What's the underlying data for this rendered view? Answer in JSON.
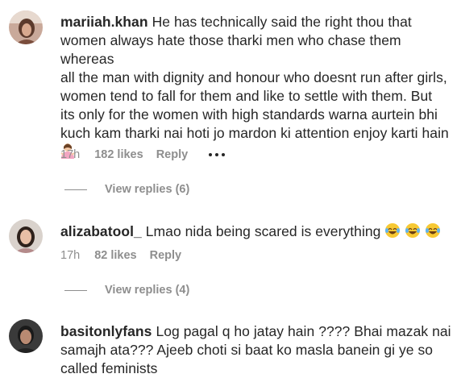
{
  "comments": [
    {
      "username": "mariiah.khan",
      "text_lines": [
        "He has technically said the right thou that",
        "women always hate those tharki men who chase them whereas",
        "all the man with dignity and honour who doesnt run after girls,",
        "women tend to fall for them and like to settle with them. But",
        "its only for the women with high standards warna aurtein bhi",
        "kuch kam tharki nai hoti jo mardon ki attention enjoy karti hain"
      ],
      "trailing_emoji": "woman-shrugging-emoji",
      "time": "17h",
      "likes": "182 likes",
      "reply": "Reply",
      "view_replies": "View replies (6)"
    },
    {
      "username": "alizabatool_",
      "text": "Lmao nida being scared is everything",
      "trailing_emoji": "laughing-tears-emoji x3",
      "time": "17h",
      "likes": "82 likes",
      "reply": "Reply",
      "view_replies": "View replies (4)"
    },
    {
      "username": "basitonlyfans",
      "text_lines": [
        "Log pagal q ho jatay hain ???? Bhai mazak nai",
        "samajh ata??? Ajeeb choti si baat ko masla banein gi ye so",
        "called feminists"
      ]
    }
  ],
  "colors": {
    "text": "#262626",
    "secondary": "#8e8e8e",
    "background": "#ffffff"
  }
}
